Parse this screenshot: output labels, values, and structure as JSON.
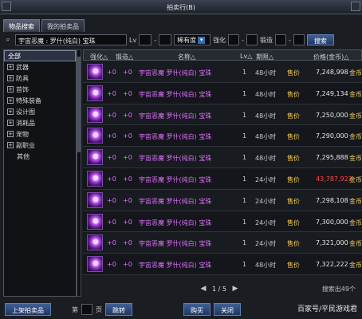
{
  "window": {
    "title": "拍卖行(B)"
  },
  "tabs": [
    {
      "label": "物品搜索",
      "active": true
    },
    {
      "label": "我的拍卖品",
      "active": false
    }
  ],
  "search": {
    "item_name": "宇宙恶魔 : 罗什(纯白) 宝珠",
    "lv_label": "Lv",
    "lv_sep": "-",
    "rarity_value": "稀有度",
    "enhance_label": "强化",
    "enhance_sep": "-",
    "forge_label": "锻造",
    "forge_sep": "-",
    "search_button": "搜索"
  },
  "sidebar": {
    "items": [
      {
        "label": "全部",
        "expandable": false,
        "active": true
      },
      {
        "label": "武器",
        "expandable": true,
        "active": false
      },
      {
        "label": "防具",
        "expandable": true,
        "active": false
      },
      {
        "label": "首饰",
        "expandable": true,
        "active": false
      },
      {
        "label": "特殊装备",
        "expandable": true,
        "active": false
      },
      {
        "label": "设计图",
        "expandable": true,
        "active": false
      },
      {
        "label": "消耗品",
        "expandable": true,
        "active": false
      },
      {
        "label": "宠物",
        "expandable": true,
        "active": false
      },
      {
        "label": "副职业",
        "expandable": true,
        "active": false
      },
      {
        "label": "其他",
        "expandable": false,
        "active": false
      }
    ]
  },
  "table": {
    "headers": {
      "enhance": "强化△",
      "forge": "锻造△",
      "name": "名称△",
      "lv": "Lv△",
      "expire": "期限△",
      "price": "价格(金币)△"
    },
    "rows": [
      {
        "enhance": "+0",
        "forge": "+0",
        "name": "宇宙恶魔 罗什(纯白) 宝珠",
        "lv": "1",
        "expire": "48小时",
        "price_label": "售价",
        "price": "7,248,998",
        "currency": "金币",
        "red": false
      },
      {
        "enhance": "+0",
        "forge": "+0",
        "name": "宇宙恶魔 罗什(纯白) 宝珠",
        "lv": "1",
        "expire": "48小时",
        "price_label": "售价",
        "price": "7,249,134",
        "currency": "金币",
        "red": false
      },
      {
        "enhance": "+0",
        "forge": "+0",
        "name": "宇宙恶魔 罗什(纯白) 宝珠",
        "lv": "1",
        "expire": "48小时",
        "price_label": "售价",
        "price": "7,250,000",
        "currency": "金币",
        "red": false
      },
      {
        "enhance": "+0",
        "forge": "+0",
        "name": "宇宙恶魔 罗什(纯白) 宝珠",
        "lv": "1",
        "expire": "48小时",
        "price_label": "售价",
        "price": "7,290,000",
        "currency": "金币",
        "red": false
      },
      {
        "enhance": "+0",
        "forge": "+0",
        "name": "宇宙恶魔 罗什(纯白) 宝珠",
        "lv": "1",
        "expire": "48小时",
        "price_label": "售价",
        "price": "7,295,888",
        "currency": "金币",
        "red": false
      },
      {
        "enhance": "+0",
        "forge": "+0",
        "name": "宇宙恶魔 罗什(纯白) 宝珠",
        "lv": "1",
        "expire": "24小时",
        "price_label": "售价",
        "price": "43,787,922",
        "currency": "金币",
        "red": true
      },
      {
        "enhance": "+0",
        "forge": "+0",
        "name": "宇宙恶魔 罗什(纯白) 宝珠",
        "lv": "1",
        "expire": "24小时",
        "price_label": "售价",
        "price": "7,298,108",
        "currency": "金币",
        "red": false
      },
      {
        "enhance": "+0",
        "forge": "+0",
        "name": "宇宙恶魔 罗什(纯白) 宝珠",
        "lv": "1",
        "expire": "24小时",
        "price_label": "售价",
        "price": "7,300,000",
        "currency": "金币",
        "red": false
      },
      {
        "enhance": "+0",
        "forge": "+0",
        "name": "宇宙恶魔 罗什(纯白) 宝珠",
        "lv": "1",
        "expire": "24小时",
        "price_label": "售价",
        "price": "7,321,000",
        "currency": "金币",
        "red": false
      },
      {
        "enhance": "+0",
        "forge": "+0",
        "name": "宇宙恶魔 罗什(纯白) 宝珠",
        "lv": "1",
        "expire": "48小时",
        "price_label": "售价",
        "price": "7,322,222",
        "currency": "金币",
        "red": false
      }
    ]
  },
  "pager": {
    "text": "1 / 5",
    "results": "搜索出49个"
  },
  "footer": {
    "list_item_button": "上架拍卖品",
    "page_prefix": "第",
    "page_suffix": "页",
    "jump_button": "跳转",
    "buy_button": "购买",
    "close_button": "关闭"
  },
  "watermark": "百家号/平民游戏君",
  "colors": {
    "item_name": "#e070ff",
    "price_label": "#ffd24d",
    "price_red": "#ff4a4a",
    "accent": "#2f6fb3"
  }
}
